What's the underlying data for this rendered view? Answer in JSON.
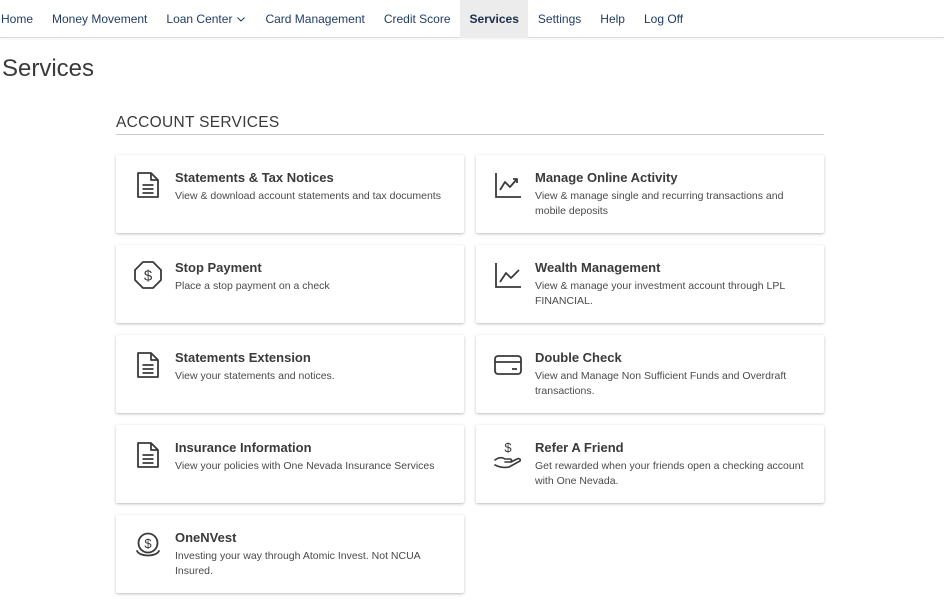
{
  "nav": {
    "items": [
      {
        "label": "Home"
      },
      {
        "label": "Money Movement"
      },
      {
        "label": "Loan Center"
      },
      {
        "label": "Card Management"
      },
      {
        "label": "Credit Score"
      },
      {
        "label": "Services"
      },
      {
        "label": "Settings"
      },
      {
        "label": "Help"
      },
      {
        "label": "Log Off"
      }
    ],
    "active": "Services"
  },
  "page": {
    "title": "Services"
  },
  "section": {
    "title": "ACCOUNT SERVICES"
  },
  "cards": [
    {
      "title": "Statements & Tax Notices",
      "desc": "View & download account statements and tax documents",
      "icon": "document-icon"
    },
    {
      "title": "Manage Online Activity",
      "desc": "View & manage single and recurring transactions and mobile deposits",
      "icon": "chart-line-icon"
    },
    {
      "title": "Stop Payment",
      "desc": "Place a stop payment on a check",
      "icon": "dollar-shield-icon"
    },
    {
      "title": "Wealth Management",
      "desc": "View & manage your investment account through LPL FINANCIAL.",
      "icon": "chart-line-icon"
    },
    {
      "title": "Statements Extension",
      "desc": "View your statements and notices.",
      "icon": "document-icon"
    },
    {
      "title": "Double Check",
      "desc": "View and Manage Non Sufficient Funds and Overdraft transactions.",
      "icon": "credit-card-icon"
    },
    {
      "title": "Insurance Information",
      "desc": "View your policies with One Nevada Insurance Services",
      "icon": "document-icon"
    },
    {
      "title": "Refer A Friend",
      "desc": "Get rewarded when your friends open a checking account with One Nevada.",
      "icon": "hand-dollar-icon"
    },
    {
      "title": "OneNVest",
      "desc": "Investing your way through Atomic Invest. Not NCUA Insured.",
      "icon": "money-bag-icon"
    }
  ]
}
